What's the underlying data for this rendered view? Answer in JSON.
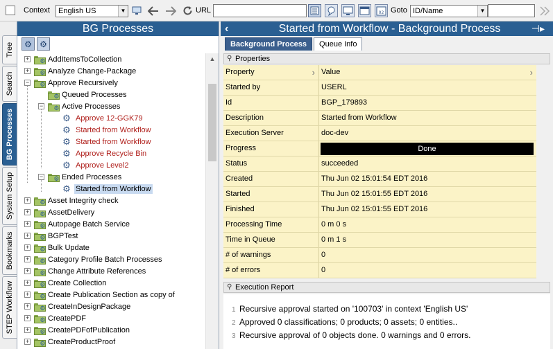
{
  "toolbar": {
    "context_label": "Context",
    "context_value": "English US",
    "url_label": "URL",
    "url_value": "",
    "goto_label": "Goto",
    "goto_type": "ID/Name",
    "goto_value": "",
    "icons": [
      "back-arrow-icon",
      "forward-arrow-icon",
      "refresh-icon",
      "view-icon",
      "chat-icon",
      "monitor-icon",
      "window-icon",
      "calendar-icon"
    ]
  },
  "vtabs": [
    "Tree",
    "Search",
    "BG Processes",
    "System Setup",
    "Bookmarks",
    "STEP Workflow"
  ],
  "left_panel": {
    "title": "BG Processes",
    "tree": [
      {
        "label": "AddItemsToCollection",
        "level": 0,
        "expander": "+",
        "icon": "folder"
      },
      {
        "label": "Analyze Change-Package",
        "level": 0,
        "expander": "+",
        "icon": "folder"
      },
      {
        "label": "Approve Recursively",
        "level": 0,
        "expander": "−",
        "icon": "folder"
      },
      {
        "label": "Queued Processes",
        "level": 1,
        "expander": "",
        "icon": "folder"
      },
      {
        "label": "Active Processes",
        "level": 1,
        "expander": "−",
        "icon": "folder"
      },
      {
        "label": "Approve 12-GGK79",
        "level": 2,
        "expander": "",
        "icon": "gear",
        "red": true
      },
      {
        "label": "Started from Workflow",
        "level": 2,
        "expander": "",
        "icon": "gear",
        "red": true
      },
      {
        "label": "Started from Workflow",
        "level": 2,
        "expander": "",
        "icon": "gear",
        "red": true
      },
      {
        "label": "Approve Recycle Bin",
        "level": 2,
        "expander": "",
        "icon": "gear",
        "red": true
      },
      {
        "label": "Approve Level2",
        "level": 2,
        "expander": "",
        "icon": "gear",
        "red": true
      },
      {
        "label": "Ended Processes",
        "level": 1,
        "expander": "−",
        "icon": "folder"
      },
      {
        "label": "Started from Workflow",
        "level": 2,
        "expander": "",
        "icon": "gear",
        "selected": true
      },
      {
        "label": "Asset Integrity check",
        "level": 0,
        "expander": "+",
        "icon": "folder"
      },
      {
        "label": "AssetDelivery",
        "level": 0,
        "expander": "+",
        "icon": "folder"
      },
      {
        "label": "Autopage Batch Service",
        "level": 0,
        "expander": "+",
        "icon": "folder"
      },
      {
        "label": "BGPTest",
        "level": 0,
        "expander": "+",
        "icon": "folder"
      },
      {
        "label": "Bulk Update",
        "level": 0,
        "expander": "+",
        "icon": "folder"
      },
      {
        "label": "Category Profile Batch Processes",
        "level": 0,
        "expander": "+",
        "icon": "folder"
      },
      {
        "label": "Change Attribute References",
        "level": 0,
        "expander": "+",
        "icon": "folder"
      },
      {
        "label": "Create Collection",
        "level": 0,
        "expander": "+",
        "icon": "folder"
      },
      {
        "label": "Create Publication Section as copy of",
        "level": 0,
        "expander": "+",
        "icon": "folder"
      },
      {
        "label": "CreateInDesignPackage",
        "level": 0,
        "expander": "+",
        "icon": "folder"
      },
      {
        "label": "CreatePDF",
        "level": 0,
        "expander": "+",
        "icon": "folder"
      },
      {
        "label": "CreatePDFofPublication",
        "level": 0,
        "expander": "+",
        "icon": "folder"
      },
      {
        "label": "CreateProductProof",
        "level": 0,
        "expander": "+",
        "icon": "folder"
      }
    ]
  },
  "right_panel": {
    "title": "Started from Workflow - Background Process",
    "tabs": [
      "Background Process",
      "Queue Info"
    ],
    "properties_title": "Properties",
    "grid_header": {
      "property": "Property",
      "value": "Value"
    },
    "properties": [
      {
        "name": "Started by",
        "value": "USERL"
      },
      {
        "name": "Id",
        "value": "BGP_179893"
      },
      {
        "name": "Description",
        "value": "Started from Workflow"
      },
      {
        "name": "Execution Server",
        "value": "doc-dev"
      },
      {
        "name": "Progress",
        "value": "Done",
        "progress": 1.0
      },
      {
        "name": "Status",
        "value": "succeeded"
      },
      {
        "name": "Created",
        "value": "Thu Jun 02 15:01:54 EDT 2016"
      },
      {
        "name": "Started",
        "value": "Thu Jun 02 15:01:55 EDT 2016"
      },
      {
        "name": "Finished",
        "value": "Thu Jun 02 15:01:55 EDT 2016"
      },
      {
        "name": "Processing Time",
        "value": "0 m 0 s"
      },
      {
        "name": "Time in Queue",
        "value": "0 m 1 s"
      },
      {
        "name": "# of warnings",
        "value": "0"
      },
      {
        "name": "# of errors",
        "value": "0"
      }
    ],
    "report_title": "Execution Report",
    "report_lines": [
      {
        "num": "1",
        "text": "Recursive approval started on '100703' in context 'English US'"
      },
      {
        "num": "2",
        "text": "Approved 0 classifications; 0 products; 0 assets; 0 entities.."
      },
      {
        "num": "3",
        "text": "Recursive approval of 0 objects done. 0 warnings and 0 errors."
      }
    ]
  }
}
